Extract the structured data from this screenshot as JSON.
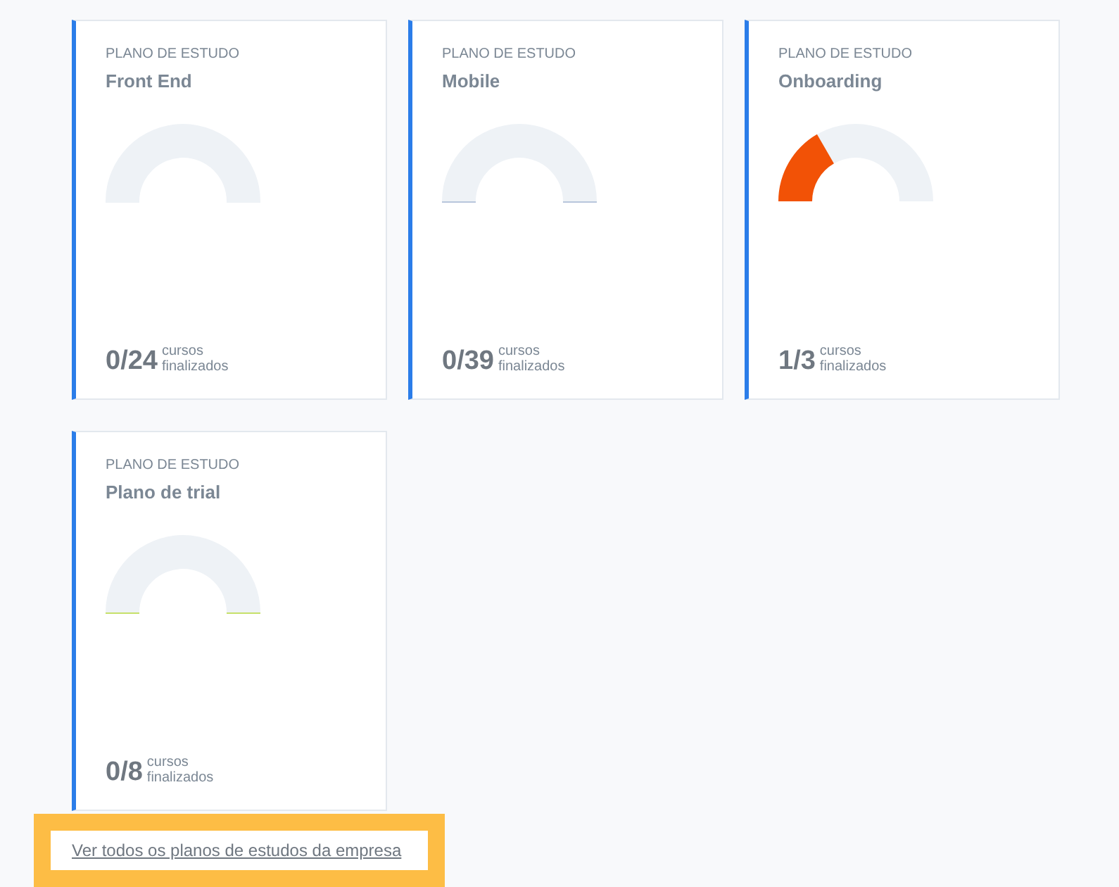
{
  "plans": [
    {
      "eyebrow": "PLANO DE ESTUDO",
      "title": "Front End",
      "color": "#eef2f6",
      "count": "0/24",
      "unit_top": "cursos",
      "unit_bottom": "finalizados"
    },
    {
      "eyebrow": "PLANO DE ESTUDO",
      "title": "Mobile",
      "color": "#b8c6dc",
      "count": "0/39",
      "unit_top": "cursos",
      "unit_bottom": "finalizados"
    },
    {
      "eyebrow": "PLANO DE ESTUDO",
      "title": "Onboarding",
      "level": 0.333,
      "color": "#f25206",
      "count": "1/3",
      "unit_top": "cursos",
      "unit_bottom": "finalizados"
    },
    {
      "eyebrow": "PLANO DE ESTUDO",
      "title": "Plano de trial",
      "color": "#c6e06a",
      "count": "0/8",
      "unit_top": "cursos",
      "unit_bottom": "finalizados"
    }
  ],
  "link": "Ver todos os planos de estudos da empresa"
}
